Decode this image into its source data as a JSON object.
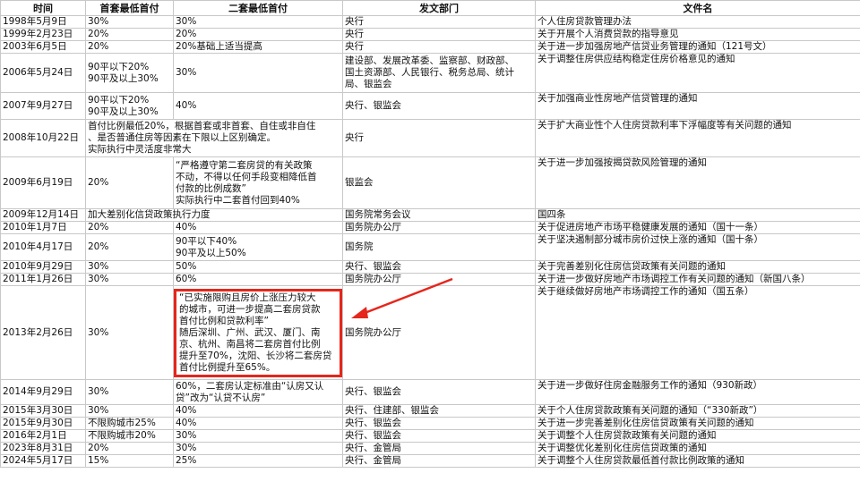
{
  "headers": [
    "时间",
    "首套最低首付",
    "二套最低首付",
    "发文部门",
    "文件名"
  ],
  "rows": [
    {
      "date": "1998年5月9日",
      "first": "30%",
      "second": "30%",
      "dept": "央行",
      "doc": "个人住房贷款管理办法"
    },
    {
      "date": "1999年2月23日",
      "first": "20%",
      "second": "20%",
      "dept": "央行",
      "doc": "关于开展个人消费贷款的指导意见"
    },
    {
      "date": "2003年6月5日",
      "first": "20%",
      "second": "20%基础上适当提高",
      "dept": "央行",
      "doc": "关于进一步加强房地产信贷业务管理的通知（121号文）"
    },
    {
      "date": "2006年5月24日",
      "first": "90平以下20%\n90平及以上30%",
      "second": "30%",
      "dept": "建设部、发展改革委、监察部、财政部、\n国土资源部、人民银行、税务总局、统计\n局、银监会",
      "doc": "关于调整住房供应结构稳定住房价格意见的通知"
    },
    {
      "date": "2007年9月27日",
      "first": "90平以下20%\n90平及以上30%",
      "second": "40%",
      "dept": "央行、银监会",
      "doc": "关于加强商业性房地产信贷管理的通知"
    },
    {
      "date": "2008年10月22日",
      "merged": "首付比例最低20%，根据首套或非首套、自住或非自住\n、是否普通住房等因素在下限以上区别确定。\n实际执行中灵活度非常大",
      "dept": "央行",
      "doc": "关于扩大商业性个人住房贷款利率下浮幅度等有关问题的通知"
    },
    {
      "date": "2009年6月19日",
      "first": "20%",
      "second": "“严格遵守第二套房贷的有关政策\n不动，不得以任何手段变相降低首\n付款的比例成数”\n实际执行中二套首付回到40%",
      "dept": "银监会",
      "doc": "关于进一步加强按揭贷款风险管理的通知"
    },
    {
      "date": "2009年12月14日",
      "merged": "加大差别化信贷政策执行力度",
      "dept": "国务院常务会议",
      "doc": "国四条"
    },
    {
      "date": "2010年1月7日",
      "first": "20%",
      "second": "40%",
      "dept": "国务院办公厅",
      "doc": "关于促进房地产市场平稳健康发展的通知（国十一条）"
    },
    {
      "date": "2010年4月17日",
      "first": "20%",
      "second": "90平以下40%\n90平及以上50%",
      "dept": "国务院",
      "doc": "关于坚决遏制部分城市房价过快上涨的通知（国十条）"
    },
    {
      "date": "2010年9月29日",
      "first": "30%",
      "second": "50%",
      "dept": "央行、银监会",
      "doc": "关于完善差别化住房信贷政策有关问题的通知"
    },
    {
      "date": "2011年1月26日",
      "first": "30%",
      "second": "60%",
      "dept": "国务院办公厅",
      "doc": "关于进一步做好房地产市场调控工作有关问题的通知（新国八条）"
    },
    {
      "date": "2013年2月26日",
      "first": "30%",
      "second": "“已实施限购且房价上涨压力较大\n的城市，可进一步提高二套房贷款\n首付比例和贷款利率”\n随后深圳、广州、武汉、厦门、南\n京、杭州、南昌将二套房首付比例\n提升至70%，沈阳、长沙将二套房贷\n首付比例提升至65%。",
      "dept": "国务院办公厅",
      "doc": "关于继续做好房地产市场调控工作的通知（国五条）"
    },
    {
      "date": "2014年9月29日",
      "first": "30%",
      "second": "60%，二套房认定标准由“认房又认\n贷”改为“认贷不认房”",
      "dept": "央行、银监会",
      "doc": "关于进一步做好住房金融服务工作的通知（930新政）"
    },
    {
      "date": "2015年3月30日",
      "first": "30%",
      "second": "40%",
      "dept": "央行、住建部、银监会",
      "doc": "关于个人住房贷款政策有关问题的通知（“330新政”）"
    },
    {
      "date": "2015年9月30日",
      "first": "不限购城市25%",
      "second": "40%",
      "dept": "央行、银监会",
      "doc": "关于进一步完善差别化住房信贷政策有关问题的通知"
    },
    {
      "date": "2016年2月1日",
      "first": "不限购城市20%",
      "second": "30%",
      "dept": "央行、银监会",
      "doc": "关于调整个人住房贷款政策有关问题的通知"
    },
    {
      "date": "2023年8月31日",
      "first": "20%",
      "second": "30%",
      "dept": "央行、金管局",
      "doc": "关于调整优化差别化住房信贷政策的通知"
    },
    {
      "date": "2024年5月17日",
      "first": "15%",
      "second": "25%",
      "dept": "央行、金管局",
      "doc": "关于调整个人住房贷款最低首付款比例政策的通知"
    }
  ],
  "colors": {
    "highlight": "#e5261c",
    "grid": "#c8c8c8"
  }
}
